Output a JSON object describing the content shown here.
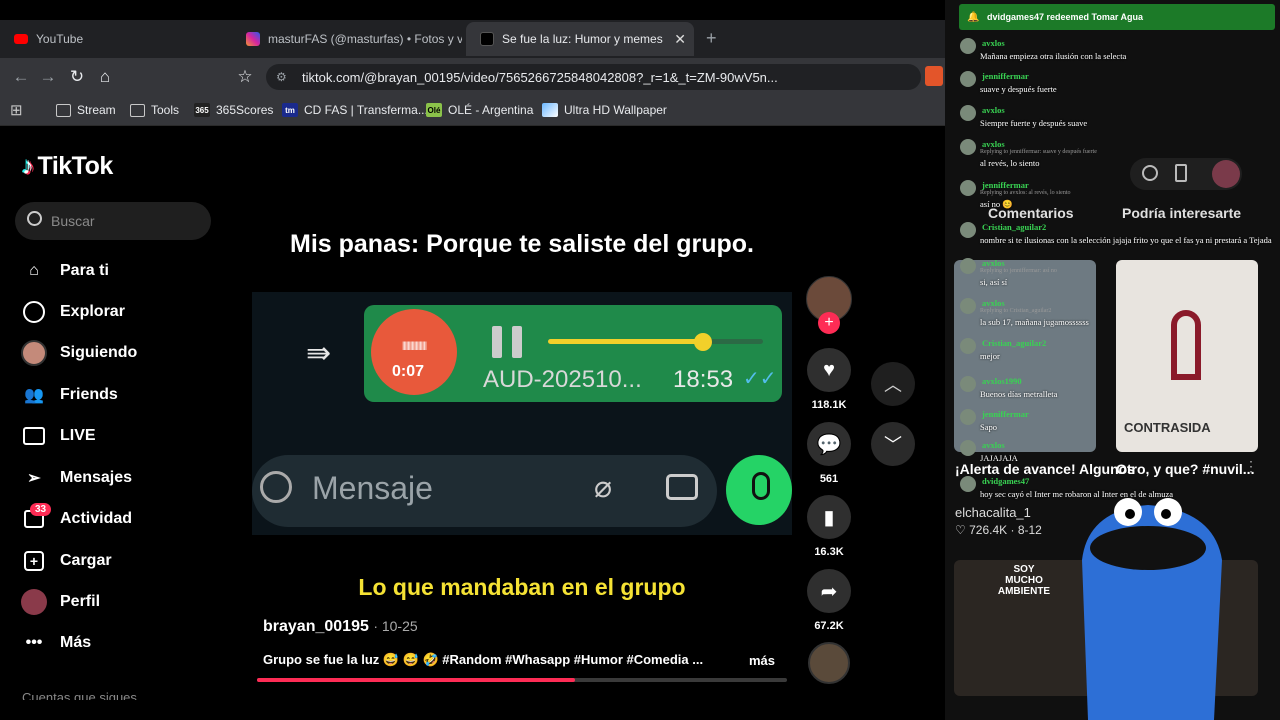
{
  "browser": {
    "tabs": [
      {
        "title": "YouTube",
        "color": "#ff0000"
      },
      {
        "title": "masturFAS (@masturfas) • Fotos y vic",
        "color": "#d6249f"
      },
      {
        "title": "Se fue la luz: Humor y memes",
        "color": "#000000"
      }
    ],
    "new_tab": "+",
    "url": "tiktok.com/@brayan_00195/video/7565266725848042808?_r=1&_t=ZM-90wV5n...",
    "bookmarks": [
      "Stream",
      "Tools",
      "365Scores",
      "CD FAS | Transferma...",
      "OLÉ - Argentina",
      "Ultra HD Wallpaper"
    ]
  },
  "tiktok": {
    "logo": "TikTok",
    "search_placeholder": "Buscar",
    "nav": [
      {
        "label": "Para ti",
        "icon": "home-icon"
      },
      {
        "label": "Explorar",
        "icon": "compass-icon"
      },
      {
        "label": "Siguiendo",
        "icon": "avatar-icon"
      },
      {
        "label": "Friends",
        "icon": "friends-icon"
      },
      {
        "label": "LIVE",
        "icon": "live-icon"
      },
      {
        "label": "Mensajes",
        "icon": "send-icon"
      },
      {
        "label": "Actividad",
        "icon": "inbox-icon"
      },
      {
        "label": "Cargar",
        "icon": "plus-icon"
      },
      {
        "label": "Perfil",
        "icon": "profile-icon"
      },
      {
        "label": "Más",
        "icon": "more-icon"
      }
    ],
    "activity_badge": "33",
    "sidebar_cutoff": "Cuentas que sigues",
    "video": {
      "caption_top": "Mis panas: Porque te saliste del grupo.",
      "audio_time": "0:07",
      "audio_file": "AUD-202510...",
      "audio_clock": "18:53",
      "message_placeholder": "Mensaje",
      "caption_bottom": "Lo que mandaban en el grupo",
      "author": "brayan_00195",
      "date": "· 10-25",
      "description": "Grupo se fue la luz 😅 😅 🤣 #Random #Whasapp #Humor #Comedia ...",
      "more": "más",
      "progress": 0.6
    },
    "actions": {
      "likes": "118.1K",
      "comments": "561",
      "saves": "16.3K",
      "shares": "67.2K"
    },
    "right_tabs": [
      "Comentarios",
      "Podría interesarte"
    ],
    "recommended": [
      {
        "title": "¡Alerta de avance! Algunos",
        "author": "elchacalita_1",
        "likes": "726.4K",
        "date": "8-12"
      },
      {
        "title": "Otro, y que? #nuvil...",
        "author": "",
        "likes": "",
        "date": ""
      }
    ],
    "thumb_texts": [
      "CONTRASIDA",
      "SOY MUCHO AMBIENTE"
    ]
  },
  "chat": {
    "banner": "dvidgames47 redeemed Tomar Agua",
    "messages": [
      {
        "user": "avxlos",
        "text": "Mañana empieza otra ilusión con la selecta",
        "reply": ""
      },
      {
        "user": "jenniffermar",
        "text": "suave y después fuerte",
        "reply": ""
      },
      {
        "user": "avxlos",
        "text": "Siempre fuerte y después suave",
        "reply": ""
      },
      {
        "user": "avxlos",
        "text": "al revés, lo siento",
        "reply": "Replying to jenniffermar: suave y después fuerte"
      },
      {
        "user": "jenniffermar",
        "text": "así no 😊",
        "reply": "Replying to avxlos: al revés, lo siento"
      },
      {
        "user": "Cristian_aguilar2",
        "text": "nombre si te ilusionas con la selección jajaja frito yo que el fas ya ni prestará a Tejada",
        "reply": ""
      },
      {
        "user": "avxlos",
        "text": "si, así sí",
        "reply": "Replying to jenniffermar: así no"
      },
      {
        "user": "avxlos",
        "text": "la sub 17, mañana jugamossssss",
        "reply": "Replying to Cristian_aguilar2"
      },
      {
        "user": "Cristian_aguilar2",
        "text": "mejor",
        "reply": ""
      },
      {
        "user": "avxlos1990",
        "text": "Buenos días metralleta",
        "reply": ""
      },
      {
        "user": "jenniffermar",
        "text": "Sapo",
        "reply": ""
      },
      {
        "user": "avxlos",
        "text": "JAJAJAJA",
        "reply": ""
      },
      {
        "user": "dvidgames47",
        "text": "hoy sec cayó el Inter me robaron al Inter en el de almuza",
        "reply": ""
      }
    ]
  }
}
